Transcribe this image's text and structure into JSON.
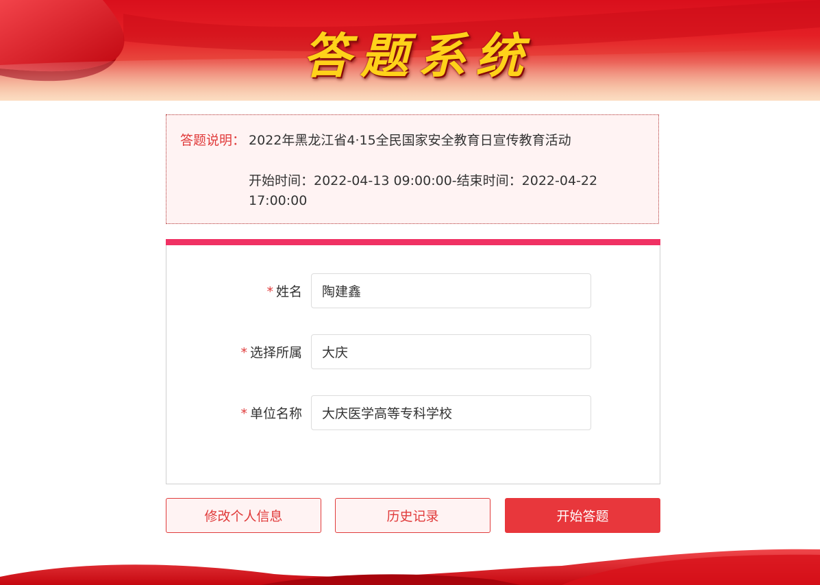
{
  "header": {
    "title": "答题系统"
  },
  "notice": {
    "label": "答题说明：",
    "description": "2022年黑龙江省4·15全民国家安全教育日宣传教育活动",
    "time": "开始时间：2022-04-13 09:00:00-结束时间：2022-04-22 17:00:00"
  },
  "form": {
    "required_mark": "*",
    "fields": [
      {
        "label": "姓名",
        "value": "陶建鑫"
      },
      {
        "label": "选择所属",
        "value": "大庆"
      },
      {
        "label": "单位名称",
        "value": "大庆医学高等专科学校"
      }
    ]
  },
  "buttons": {
    "edit_profile": "修改个人信息",
    "history": "历史记录",
    "start": "开始答题"
  },
  "colors": {
    "brand_red": "#e8373c",
    "accent_pink": "#f03163",
    "notice_bg": "#fff3f3",
    "title_gold": "#ffd21a"
  }
}
